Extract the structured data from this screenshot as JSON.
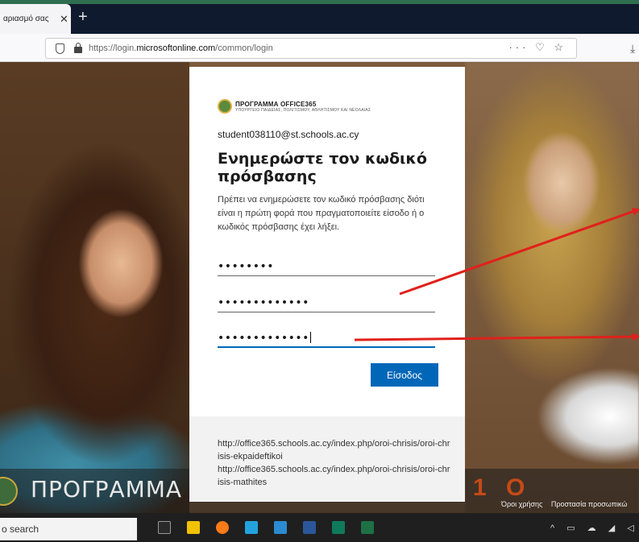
{
  "browser": {
    "tab_title": "αριασμό σας",
    "tab_close": "✕",
    "new_tab": "+",
    "url_prefix": "https://login.",
    "url_domain": "microsoftonline.com",
    "url_path": "/common/login",
    "url_actions": "··· ♡ ☆",
    "download_glyph": "⤓"
  },
  "background": {
    "program_title": "ΠΡΟΓΡΑΜΜΑ OFFIC",
    "footer_links": [
      "Όροι χρήσης",
      "Προστασία προσωπικώ"
    ]
  },
  "card": {
    "brand_name": "ΠΡΟΓΡΑΜΜΑ OFFICE365",
    "brand_sub": "ΥΠΟΥΡΓΕΙΟ ΠΑΙΔΕΙΑΣ, ΠΟΛΙΤΙΣΜΟΥ, ΑΘΛΗΤΙΣΜΟΥ ΚΑΙ ΝΕΟΛΑΙΑΣ",
    "user_email": "student038110@st.schools.ac.cy",
    "heading": "Ενημερώστε τον κωδικό πρόσβασης",
    "description": "Πρέπει να ενημερώσετε τον κωδικό πρόσβασης διότι είναι η πρώτη φορά που πραγματοποιείτε είσοδο ή ο κωδικός πρόσβασης έχει λήξει.",
    "current_password": "••••••••",
    "new_password": "•••••••••••••",
    "confirm_password": "•••••••••••••",
    "signin_label": "Είσοδος",
    "terms_link_1": "http://office365.schools.ac.cy/index.php/oroi-chrisis/oroi-chrisis-ekpaideftikoi",
    "terms_link_2": "http://office365.schools.ac.cy/index.php/oroi-chrisis/oroi-chrisis-mathites"
  },
  "annotations": {
    "arrow_color": "#e0211b"
  },
  "taskbar": {
    "search_text": "o search",
    "tray_text": "^ ▭ ☁ ◢ ◁×"
  },
  "colors": {
    "accent": "#0067b8"
  }
}
